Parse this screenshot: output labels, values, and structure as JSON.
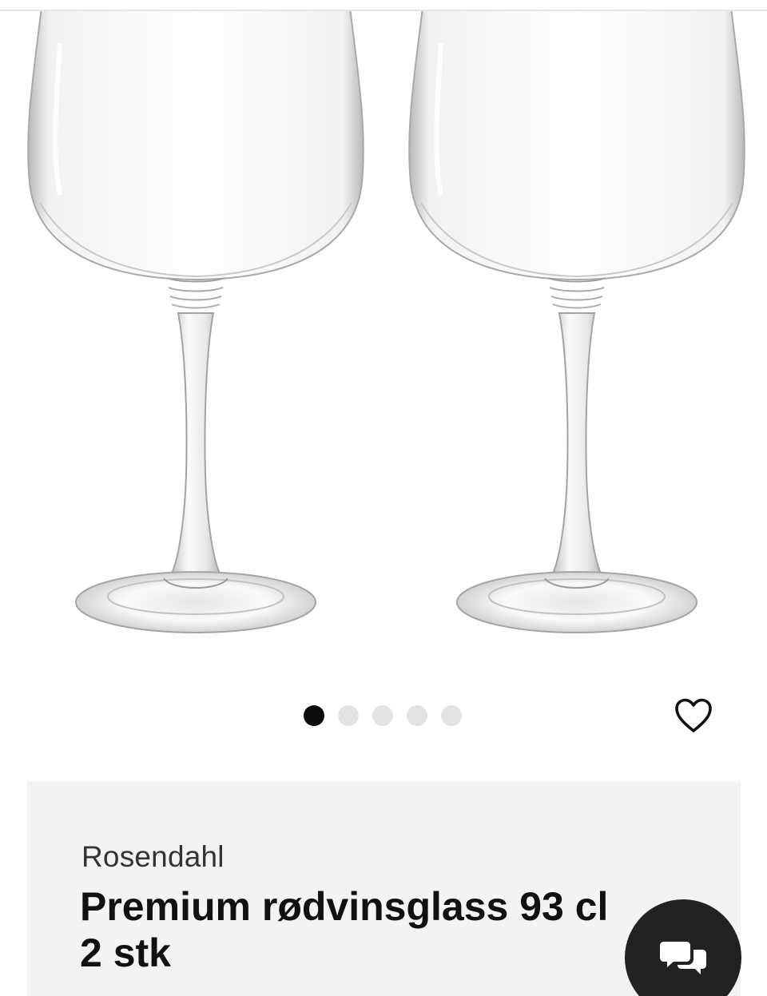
{
  "gallery": {
    "current_slide": 1,
    "slide_count": 5,
    "image_alt": "Rosendahl Premium rødvinsglass 93 cl 2 stk"
  },
  "product": {
    "brand": "Rosendahl",
    "title": "Premium rødvinsglass 93 cl 2 stk"
  },
  "icons": {
    "wishlist": "heart-outline-icon",
    "chat": "chat-bubbles-icon"
  },
  "colors": {
    "active_dot": "#0c0c0c",
    "inactive_dot": "#e3e3e3",
    "card_background": "#f3f3f3",
    "chat_button": "#222222"
  }
}
